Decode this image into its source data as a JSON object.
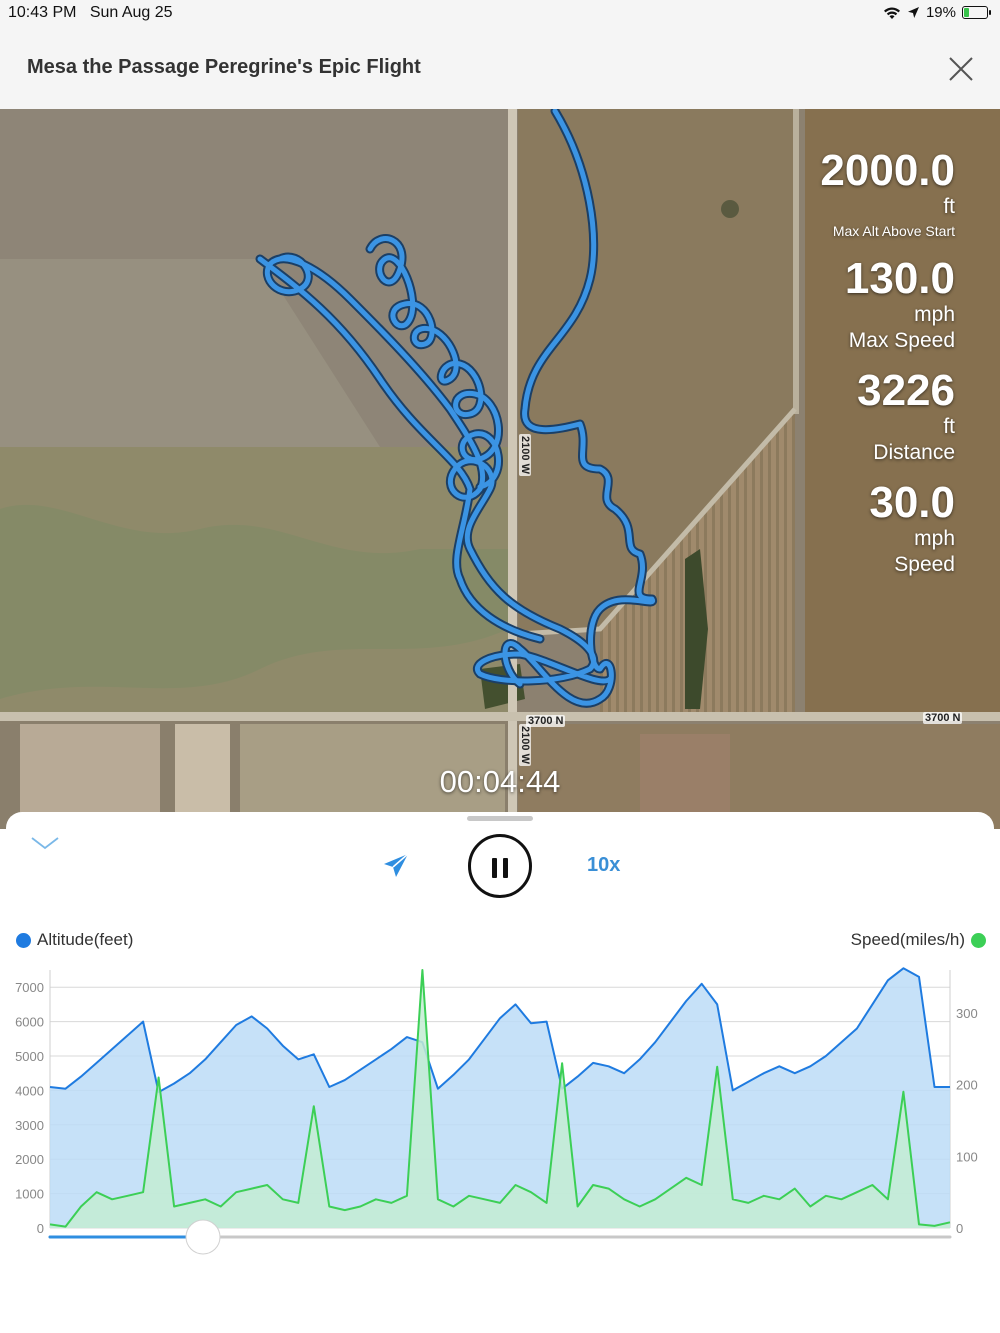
{
  "status_bar": {
    "time": "10:43 PM",
    "date": "Sun Aug 25",
    "battery": "19%",
    "battery_level": 0.19,
    "icons": [
      "wifi-icon",
      "location-arrow-icon",
      "battery-charging-icon"
    ]
  },
  "header": {
    "title": "Mesa the Passage Peregrine's Epic Flight",
    "close_icon": "close-icon"
  },
  "map": {
    "road_labels": [
      "2100 W",
      "2100 W",
      "3700 N",
      "3700 N"
    ],
    "track_color": "#2f8ee0",
    "stats": [
      {
        "value": "2000.0",
        "unit": "ft",
        "caption": "Max Alt Above Start"
      },
      {
        "value": "130.0",
        "unit": "mph",
        "caption": "Max Speed"
      },
      {
        "value": "3226",
        "unit": "ft",
        "caption": "Distance"
      },
      {
        "value": "30.0",
        "unit": "mph",
        "caption": "Speed"
      }
    ],
    "elapsed_time": "00:04:44"
  },
  "controls": {
    "collapse_icon": "chevron-down-icon",
    "send_icon": "paper-plane-icon",
    "pause_icon": "pause-icon",
    "playback_speed": "10x",
    "progress": 0.17
  },
  "chart_data": {
    "type": "area",
    "legend": [
      {
        "name": "Altitude(feet)",
        "color": "#1f7be0",
        "position": "top-left"
      },
      {
        "name": "Speed(miles/h)",
        "color": "#3ccf56",
        "position": "top-right"
      }
    ],
    "left_axis": {
      "ticks": [
        "0",
        "1000",
        "2000",
        "3000",
        "4000",
        "5000",
        "6000",
        "7000"
      ],
      "range": [
        0,
        7500
      ]
    },
    "right_axis": {
      "ticks": [
        "0",
        "100",
        "200",
        "300"
      ],
      "range": [
        0,
        360
      ]
    },
    "grid": true,
    "series": [
      {
        "name": "Altitude(feet)",
        "axis": "left",
        "color": "#1f7be0",
        "fill": "#bcdcf7",
        "values": [
          4100,
          4050,
          4400,
          4800,
          5200,
          5600,
          6000,
          3950,
          4200,
          4500,
          4900,
          5400,
          5900,
          6150,
          5800,
          5300,
          4900,
          5050,
          4100,
          4300,
          4600,
          4900,
          5200,
          5550,
          5400,
          4050,
          4450,
          4900,
          5500,
          6100,
          6500,
          5950,
          6000,
          4050,
          4400,
          4800,
          4700,
          4500,
          4900,
          5400,
          6000,
          6600,
          7100,
          6500,
          4000,
          4250,
          4500,
          4700,
          4500,
          4700,
          5000,
          5400,
          5800,
          6500,
          7200,
          7550,
          7300,
          4100,
          4100
        ]
      },
      {
        "name": "Speed(miles/h)",
        "axis": "right",
        "color": "#3ccf56",
        "fill": "#c3ecd3",
        "values": [
          5,
          2,
          30,
          50,
          40,
          45,
          50,
          210,
          30,
          35,
          40,
          30,
          50,
          55,
          60,
          40,
          35,
          170,
          30,
          25,
          30,
          40,
          35,
          45,
          360,
          40,
          30,
          45,
          40,
          35,
          60,
          50,
          35,
          230,
          30,
          60,
          55,
          40,
          30,
          40,
          55,
          70,
          60,
          225,
          40,
          35,
          45,
          40,
          55,
          30,
          45,
          40,
          50,
          60,
          40,
          190,
          5,
          3,
          8
        ]
      }
    ]
  }
}
